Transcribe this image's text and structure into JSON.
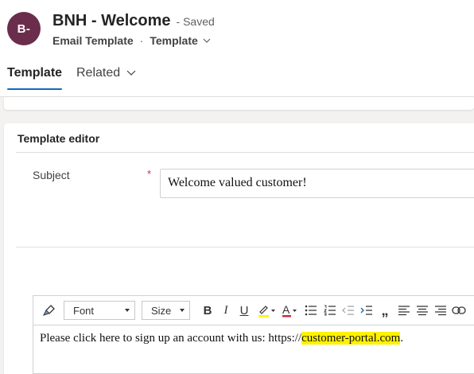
{
  "record": {
    "avatar_initials": "B-",
    "avatar_color": "#6b2d4c",
    "title": "BNH - Welcome",
    "status": "- Saved",
    "entity": "Email Template",
    "separator": "·",
    "form_name": "Template"
  },
  "tabs": [
    {
      "label": "Template",
      "selected": true
    },
    {
      "label": "Related",
      "selected": false
    }
  ],
  "section": {
    "title": "Template editor"
  },
  "subject": {
    "label": "Subject",
    "required_mark": "*",
    "value": "Welcome valued customer!"
  },
  "toolbar": {
    "font_label": "Font",
    "size_label": "Size",
    "buttons": [
      "format-painter-icon",
      "bold-icon",
      "italic-icon",
      "underline-icon",
      "highlight-color-icon",
      "font-color-icon",
      "bulleted-list-icon",
      "numbered-list-icon",
      "decrease-indent-icon",
      "increase-indent-icon",
      "quote-icon",
      "align-left-icon",
      "align-center-icon",
      "align-right-icon",
      "link-icon"
    ]
  },
  "editor": {
    "text_before": "Please click here to sign up an account with us: https://",
    "highlighted_text": "customer-portal.com",
    "text_after": "."
  },
  "colors": {
    "accent": "#0f6cbd",
    "required": "#c4314b",
    "highlight": "#fff200"
  }
}
